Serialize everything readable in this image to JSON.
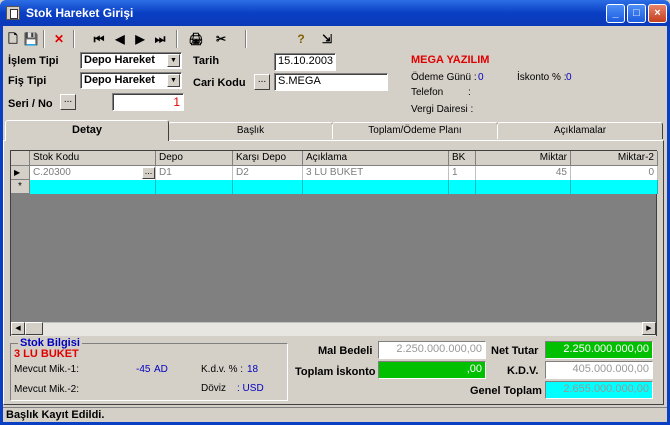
{
  "window": {
    "title": "Stok Hareket Girişi",
    "min": "_",
    "max": "□",
    "close": "×"
  },
  "form": {
    "islem_tipi_label": "İşlem Tipi",
    "islem_tipi_value": "Depo Hareket",
    "fis_tipi_label": "Fiş Tipi",
    "fis_tipi_value": "Depo Hareket",
    "seri_no_label": "Seri / No",
    "seri_no_value": "1",
    "seri_btn": "...",
    "tarih_label": "Tarih",
    "tarih_value": "15.10.2003",
    "cari_kodu_label": "Cari Kodu",
    "cari_kodu_value": "S.MEGA",
    "cari_btn": "..."
  },
  "cari": {
    "name": "MEGA YAZILIM",
    "odeme_gunu_label": "Ödeme Günü :",
    "odeme_gunu_value": "0",
    "iskonto_label": "İskonto % :",
    "iskonto_value": "0",
    "telefon_label": "Telefon",
    "telefon_sep": ":",
    "vergi_label": "Vergi Dairesi :"
  },
  "tabs": [
    "Detay",
    "Başlık",
    "Toplam/Ödeme Planı",
    "Açıklamalar"
  ],
  "grid": {
    "columns": [
      "Stok Kodu",
      "Depo",
      "Karşı Depo",
      "Açıklama",
      "BK",
      "Miktar",
      "Miktar-2"
    ],
    "rows": [
      [
        "C.20300",
        "D1",
        "D2",
        "3 LU BUKET",
        "1",
        "45",
        "0"
      ]
    ],
    "row_btn": "...",
    "new_row_marker": "*",
    "current_row_marker": "▶"
  },
  "stock_info": {
    "title": "Stok Bilgisi",
    "product": "3 LU BUKET",
    "mevcut1_label": "Mevcut Mik.-1:",
    "mevcut1_value": "-45",
    "mevcut1_unit": "AD",
    "mevcut2_label": "Mevcut Mik.-2:",
    "kdv_label": "K.d.v. % :",
    "kdv_value": "18",
    "doviz_label": "Döviz",
    "doviz_value": ": USD"
  },
  "totals": {
    "mal_bedeli_label": "Mal Bedeli",
    "mal_bedeli_value": "2.250.000.000,00",
    "toplam_iskonto_label": "Toplam İskonto",
    "toplam_iskonto_value": ",00",
    "net_tutar_label": "Net Tutar",
    "net_tutar_value": "2.250.000.000,00",
    "kdv_label": "K.D.V.",
    "kdv_value": "405.000.000,00",
    "genel_toplam_label": "Genel Toplam",
    "genel_toplam_value": "2.655.000.000,00"
  },
  "status": {
    "text": "Başlık Kayıt Edildi."
  },
  "toolbar": {
    "new": "🗋",
    "save": "💾",
    "delete": "✕",
    "first": "⏮",
    "prev": "◀",
    "next": "▶",
    "last": "⏭",
    "print": "🖨",
    "tools": "✂",
    "help": "?",
    "exit": "⇲"
  },
  "colors": {
    "accent_red": "#e00000",
    "label_blue": "#0000c0",
    "net_green": "#00c000",
    "cyan": "#00ffff",
    "titlebar": "#0a3fc4"
  }
}
